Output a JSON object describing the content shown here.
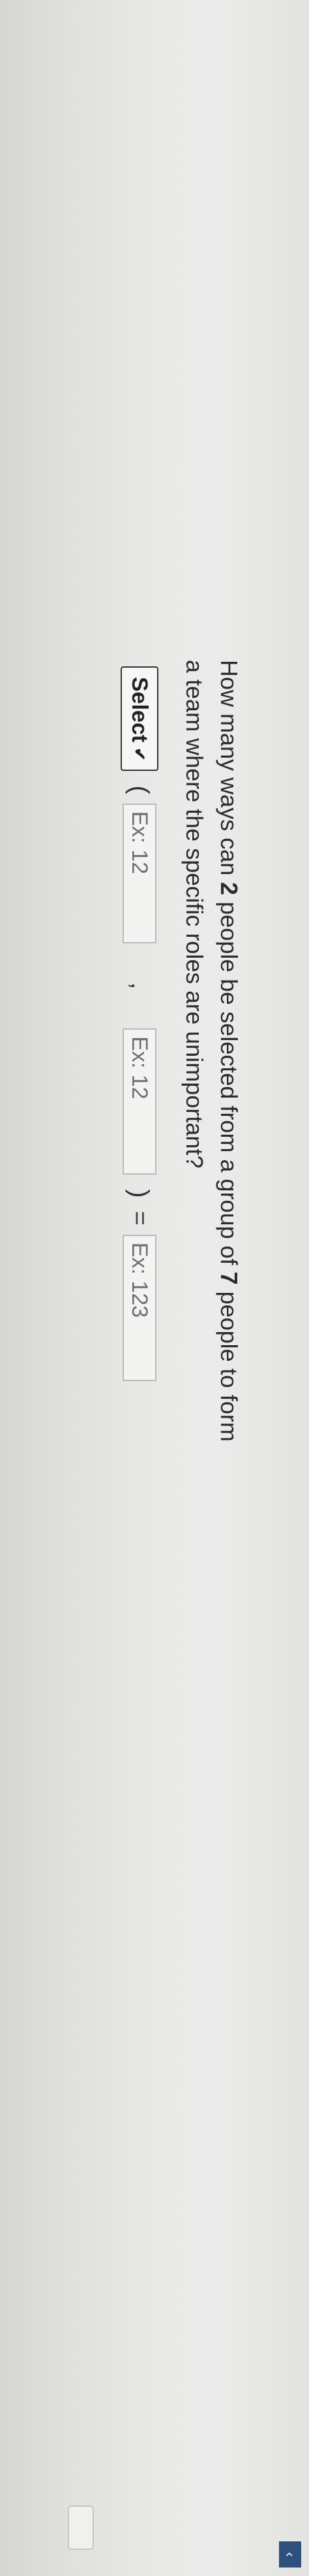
{
  "question": {
    "part1": "How many ways can ",
    "num1": "2",
    "part2": " people be selected from a group of ",
    "num2": "7",
    "part3": " people to form a team where the specific roles are unimportant?"
  },
  "answer": {
    "select_label": "Select",
    "open_paren": "(",
    "input1_placeholder": "Ex: 12",
    "comma": ",",
    "input2_placeholder": "Ex: 12",
    "close_paren": ")",
    "equals": "=",
    "result_placeholder": "Ex: 123"
  },
  "icons": {
    "select_chevron": "chevron-down-icon",
    "corner": "chevron-icon"
  }
}
